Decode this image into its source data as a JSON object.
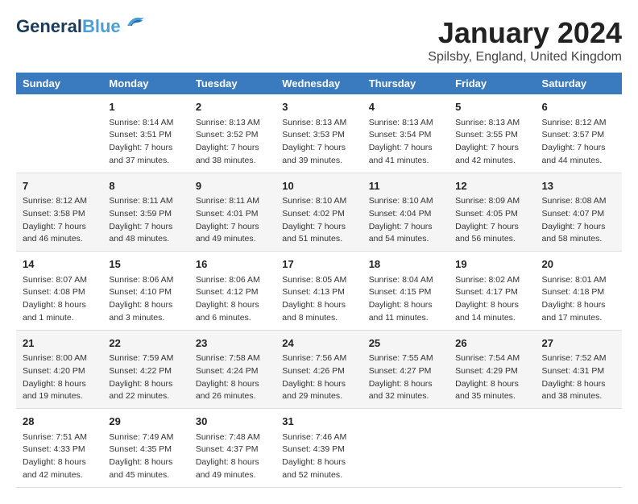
{
  "header": {
    "logo_line1": "General",
    "logo_line2": "Blue",
    "month": "January 2024",
    "location": "Spilsby, England, United Kingdom"
  },
  "days_of_week": [
    "Sunday",
    "Monday",
    "Tuesday",
    "Wednesday",
    "Thursday",
    "Friday",
    "Saturday"
  ],
  "weeks": [
    [
      {
        "day": "",
        "info": ""
      },
      {
        "day": "1",
        "info": "Sunrise: 8:14 AM\nSunset: 3:51 PM\nDaylight: 7 hours\nand 37 minutes."
      },
      {
        "day": "2",
        "info": "Sunrise: 8:13 AM\nSunset: 3:52 PM\nDaylight: 7 hours\nand 38 minutes."
      },
      {
        "day": "3",
        "info": "Sunrise: 8:13 AM\nSunset: 3:53 PM\nDaylight: 7 hours\nand 39 minutes."
      },
      {
        "day": "4",
        "info": "Sunrise: 8:13 AM\nSunset: 3:54 PM\nDaylight: 7 hours\nand 41 minutes."
      },
      {
        "day": "5",
        "info": "Sunrise: 8:13 AM\nSunset: 3:55 PM\nDaylight: 7 hours\nand 42 minutes."
      },
      {
        "day": "6",
        "info": "Sunrise: 8:12 AM\nSunset: 3:57 PM\nDaylight: 7 hours\nand 44 minutes."
      }
    ],
    [
      {
        "day": "7",
        "info": "Sunrise: 8:12 AM\nSunset: 3:58 PM\nDaylight: 7 hours\nand 46 minutes."
      },
      {
        "day": "8",
        "info": "Sunrise: 8:11 AM\nSunset: 3:59 PM\nDaylight: 7 hours\nand 48 minutes."
      },
      {
        "day": "9",
        "info": "Sunrise: 8:11 AM\nSunset: 4:01 PM\nDaylight: 7 hours\nand 49 minutes."
      },
      {
        "day": "10",
        "info": "Sunrise: 8:10 AM\nSunset: 4:02 PM\nDaylight: 7 hours\nand 51 minutes."
      },
      {
        "day": "11",
        "info": "Sunrise: 8:10 AM\nSunset: 4:04 PM\nDaylight: 7 hours\nand 54 minutes."
      },
      {
        "day": "12",
        "info": "Sunrise: 8:09 AM\nSunset: 4:05 PM\nDaylight: 7 hours\nand 56 minutes."
      },
      {
        "day": "13",
        "info": "Sunrise: 8:08 AM\nSunset: 4:07 PM\nDaylight: 7 hours\nand 58 minutes."
      }
    ],
    [
      {
        "day": "14",
        "info": "Sunrise: 8:07 AM\nSunset: 4:08 PM\nDaylight: 8 hours\nand 1 minute."
      },
      {
        "day": "15",
        "info": "Sunrise: 8:06 AM\nSunset: 4:10 PM\nDaylight: 8 hours\nand 3 minutes."
      },
      {
        "day": "16",
        "info": "Sunrise: 8:06 AM\nSunset: 4:12 PM\nDaylight: 8 hours\nand 6 minutes."
      },
      {
        "day": "17",
        "info": "Sunrise: 8:05 AM\nSunset: 4:13 PM\nDaylight: 8 hours\nand 8 minutes."
      },
      {
        "day": "18",
        "info": "Sunrise: 8:04 AM\nSunset: 4:15 PM\nDaylight: 8 hours\nand 11 minutes."
      },
      {
        "day": "19",
        "info": "Sunrise: 8:02 AM\nSunset: 4:17 PM\nDaylight: 8 hours\nand 14 minutes."
      },
      {
        "day": "20",
        "info": "Sunrise: 8:01 AM\nSunset: 4:18 PM\nDaylight: 8 hours\nand 17 minutes."
      }
    ],
    [
      {
        "day": "21",
        "info": "Sunrise: 8:00 AM\nSunset: 4:20 PM\nDaylight: 8 hours\nand 19 minutes."
      },
      {
        "day": "22",
        "info": "Sunrise: 7:59 AM\nSunset: 4:22 PM\nDaylight: 8 hours\nand 22 minutes."
      },
      {
        "day": "23",
        "info": "Sunrise: 7:58 AM\nSunset: 4:24 PM\nDaylight: 8 hours\nand 26 minutes."
      },
      {
        "day": "24",
        "info": "Sunrise: 7:56 AM\nSunset: 4:26 PM\nDaylight: 8 hours\nand 29 minutes."
      },
      {
        "day": "25",
        "info": "Sunrise: 7:55 AM\nSunset: 4:27 PM\nDaylight: 8 hours\nand 32 minutes."
      },
      {
        "day": "26",
        "info": "Sunrise: 7:54 AM\nSunset: 4:29 PM\nDaylight: 8 hours\nand 35 minutes."
      },
      {
        "day": "27",
        "info": "Sunrise: 7:52 AM\nSunset: 4:31 PM\nDaylight: 8 hours\nand 38 minutes."
      }
    ],
    [
      {
        "day": "28",
        "info": "Sunrise: 7:51 AM\nSunset: 4:33 PM\nDaylight: 8 hours\nand 42 minutes."
      },
      {
        "day": "29",
        "info": "Sunrise: 7:49 AM\nSunset: 4:35 PM\nDaylight: 8 hours\nand 45 minutes."
      },
      {
        "day": "30",
        "info": "Sunrise: 7:48 AM\nSunset: 4:37 PM\nDaylight: 8 hours\nand 49 minutes."
      },
      {
        "day": "31",
        "info": "Sunrise: 7:46 AM\nSunset: 4:39 PM\nDaylight: 8 hours\nand 52 minutes."
      },
      {
        "day": "",
        "info": ""
      },
      {
        "day": "",
        "info": ""
      },
      {
        "day": "",
        "info": ""
      }
    ]
  ]
}
